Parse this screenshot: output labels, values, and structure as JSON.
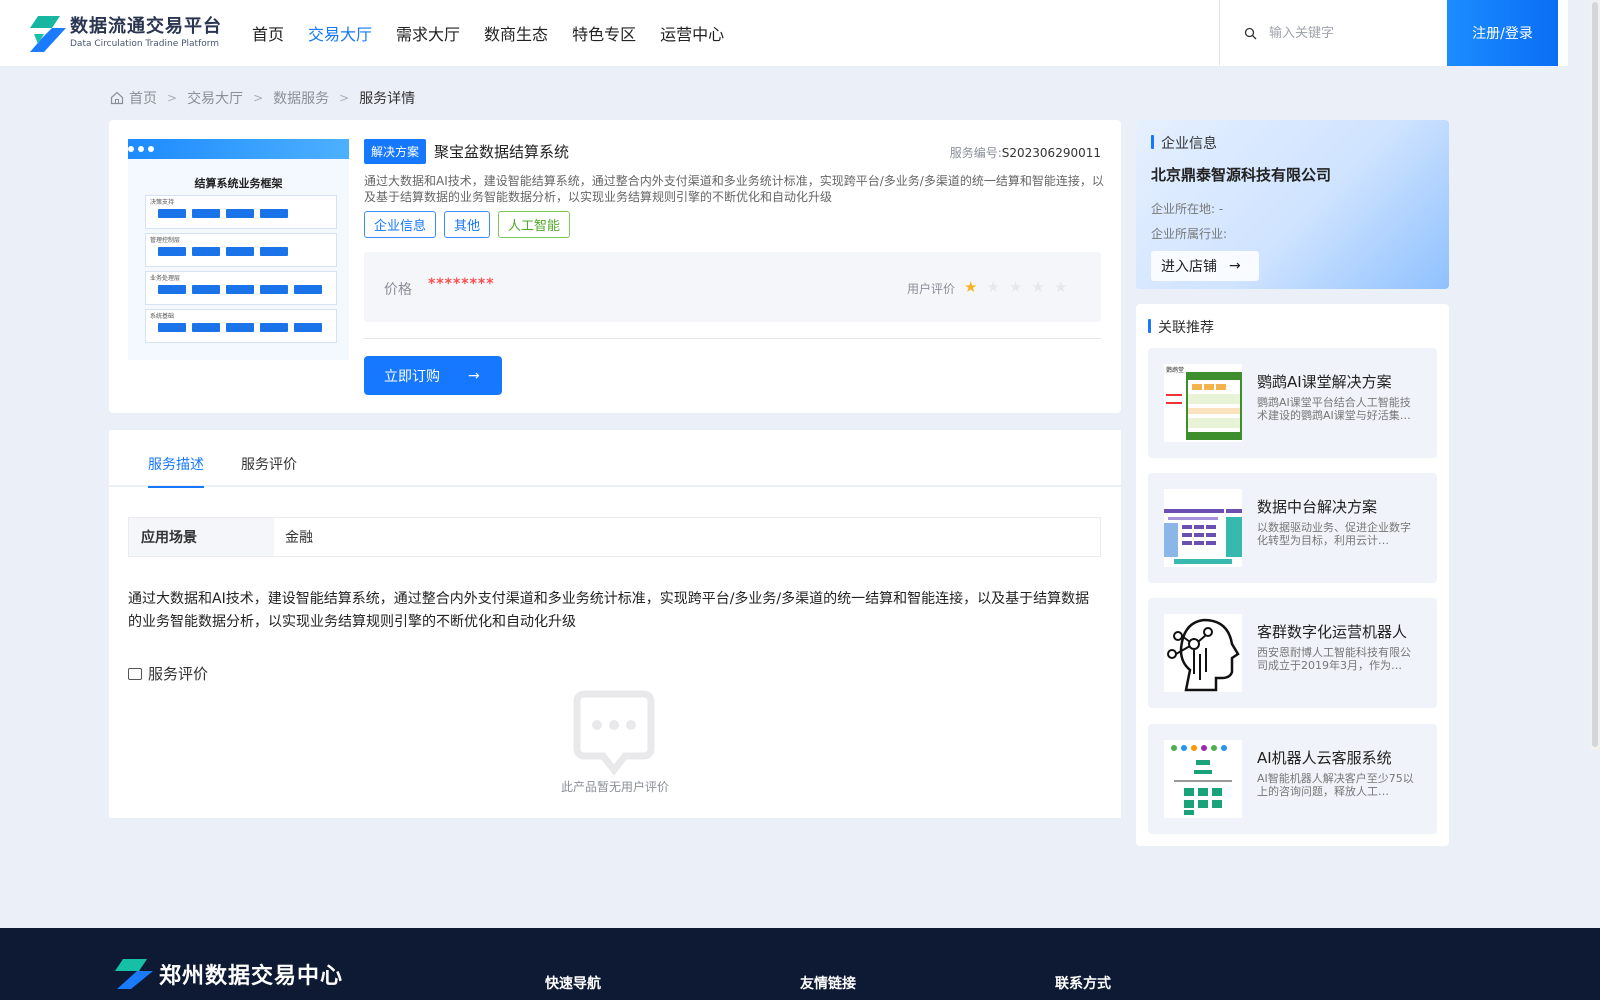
{
  "header": {
    "logo_cn": "数据流通交易平台",
    "logo_en": "Data Circulation Tradine Platform",
    "nav": [
      {
        "label": "首页",
        "active": false
      },
      {
        "label": "交易大厅",
        "active": true
      },
      {
        "label": "需求大厅",
        "active": false
      },
      {
        "label": "数商生态",
        "active": false
      },
      {
        "label": "特色专区",
        "active": false
      },
      {
        "label": "运营中心",
        "active": false
      }
    ],
    "search_placeholder": "输入关键字",
    "login_label": "注册/登录"
  },
  "breadcrumb": [
    "首页",
    "交易大厅",
    "数据服务",
    "服务详情"
  ],
  "product": {
    "image": {
      "title": "结算系统业务框架",
      "layers": [
        "决策支持",
        "管理控制层",
        "业务处理层",
        "系统基础"
      ]
    },
    "type_tag": "解决方案",
    "title": "聚宝盆数据结算系统",
    "service_no_label": "服务编号:",
    "service_no": "S202306290011",
    "description": "通过大数据和AI技术，建设智能结算系统，通过整合内外支付渠道和多业务统计标准，实现跨平台/多业务/多渠道的统一结算和智能连接，以及基于结算数据的业务智能数据分析，以实现业务结算规则引擎的不断优化和自动化升级",
    "tags": [
      "企业信息",
      "其他",
      "人工智能"
    ],
    "price_label": "价格",
    "price_value": "********",
    "rating_label": "用户评价",
    "rating": 1,
    "rating_max": 5,
    "buy_label": "立即订购"
  },
  "detail": {
    "tabs": [
      {
        "label": "服务描述",
        "active": true
      },
      {
        "label": "服务评价",
        "active": false
      }
    ],
    "scene_key": "应用场景",
    "scene_value": "金融",
    "full_description": "通过大数据和AI技术，建设智能结算系统，通过整合内外支付渠道和多业务统计标准，实现跨平台/多业务/多渠道的统一结算和智能连接，以及基于结算数据的业务智能数据分析，以实现业务结算规则引擎的不断优化和自动化升级",
    "review_title": "服务评价",
    "empty_review": "此产品暂无用户评价"
  },
  "company": {
    "section_title": "企业信息",
    "name": "北京鼎泰智源科技有限公司",
    "location_label": "企业所在地:",
    "location_value": "-",
    "industry_label": "企业所属行业:",
    "industry_value": "",
    "store_label": "进入店铺"
  },
  "recommend": {
    "section_title": "关联推荐",
    "items": [
      {
        "title": "鹦鹉AI课堂解决方案",
        "desc": "鹦鹉AI课堂平台结合人工智能技术建设的鹦鹉AI课堂与好活集…",
        "thumb_label": "鹦鹉堂"
      },
      {
        "title": "数据中台解决方案",
        "desc": "以数据驱动业务、促进企业数字化转型为目标，利用云计…"
      },
      {
        "title": "客群数字化运营机器人",
        "desc": "西安恩耐博人工智能科技有限公司成立于2019年3月，作为…"
      },
      {
        "title": "AI机器人云客服系统",
        "desc": "AI智能机器人解决客户至少75以上的咨询问题，释放人工…"
      }
    ]
  },
  "footer": {
    "title": "郑州数据交易中心",
    "col1": "快速导航",
    "col2": "友情链接",
    "col3": "联系方式"
  },
  "colors": {
    "primary": "#1677ff",
    "price": "#ff4d4f",
    "star": "#fab320",
    "footer_bg": "#0e1a33"
  }
}
